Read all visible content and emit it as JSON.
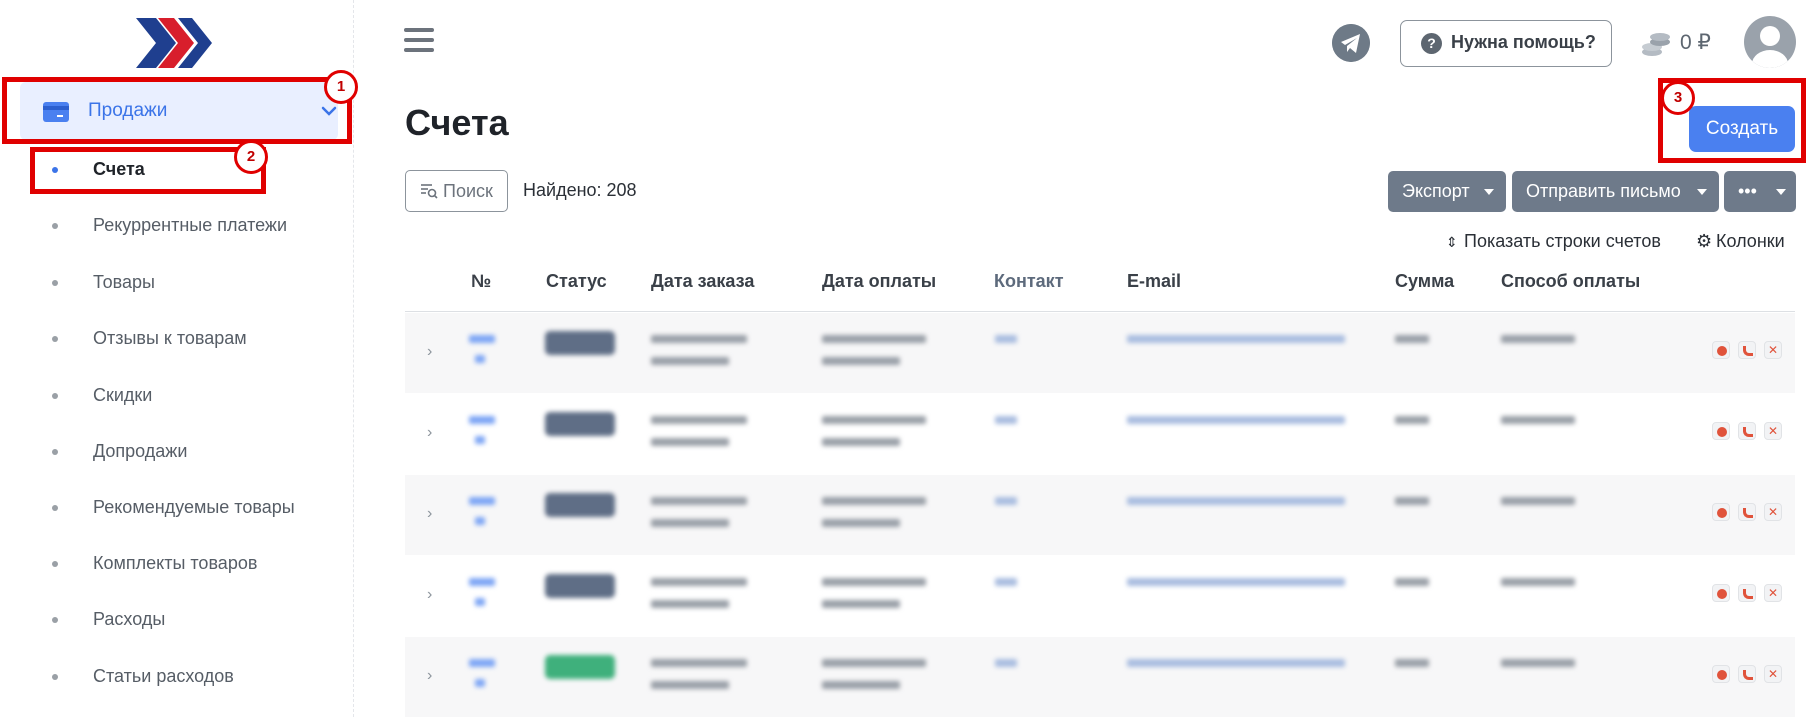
{
  "sidebar": {
    "logo": "brand-chevrons-logo",
    "section": {
      "label": "Продажи",
      "icon": "wallet-icon"
    },
    "items": [
      {
        "label": "Счета",
        "active": true
      },
      {
        "label": "Рекуррентные платежи"
      },
      {
        "label": "Товары"
      },
      {
        "label": "Отзывы к товарам"
      },
      {
        "label": "Скидки"
      },
      {
        "label": "Допродажи"
      },
      {
        "label": "Рекомендуемые товары"
      },
      {
        "label": "Комплекты товаров"
      },
      {
        "label": "Расходы"
      },
      {
        "label": "Статьи расходов"
      }
    ]
  },
  "topbar": {
    "help_label": "Нужна помощь?",
    "balance": "0 ₽"
  },
  "page": {
    "title": "Счета",
    "create_label": "Создать"
  },
  "toolbar": {
    "search_label": "Поиск",
    "found_text": "Найдено: 208",
    "export_label": "Экспорт",
    "send_email_label": "Отправить письмо",
    "more_label": "•••",
    "show_rows_label": "Показать строки счетов",
    "columns_label": "Колонки"
  },
  "table": {
    "columns": [
      "№",
      "Статус",
      "Дата заказа",
      "Дата оплаты",
      "Контакт",
      "E-mail",
      "Сумма",
      "Способ оплаты"
    ],
    "rows": [
      {
        "status_color": "#5f6e86"
      },
      {
        "status_color": "#5f6e86"
      },
      {
        "status_color": "#5f6e86"
      },
      {
        "status_color": "#5f6e86"
      },
      {
        "status_color": "#3fb07c"
      }
    ]
  },
  "annotations": [
    "1",
    "2",
    "3"
  ],
  "colors": {
    "accent": "#4a80f0",
    "annotation": "#e00000",
    "button_gray": "#6e7a8a"
  }
}
